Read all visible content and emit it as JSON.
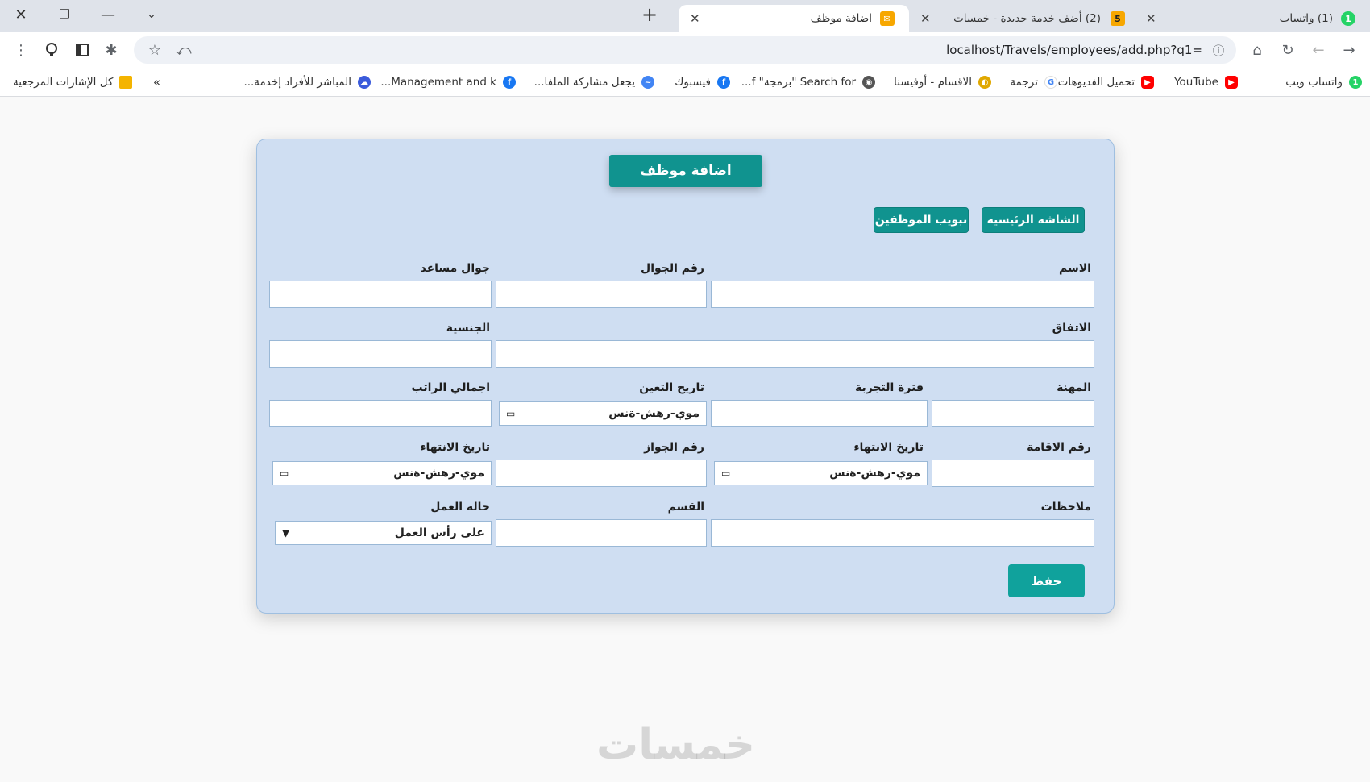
{
  "browser": {
    "tabs": [
      {
        "title": "(1) واتساب",
        "favicon": "whatsapp-icon"
      },
      {
        "title": "(2) أضف خدمة جديدة - خمسات",
        "favicon_text": "5"
      },
      {
        "title": "اضافة موظف",
        "favicon": "page-icon"
      }
    ],
    "url": "localhost/Travels/employees/add.php?q1=",
    "bookmarks": [
      {
        "label": "واتساب ويب",
        "icon": "whatsapp-icon",
        "color": "#25d366"
      },
      {
        "label": "YouTube",
        "icon": "youtube-icon",
        "color": "#ff0000"
      },
      {
        "label": "تحميل الفديوهات",
        "icon": "youtube-icon",
        "color": "#ff0000"
      },
      {
        "label": "ترجمة",
        "icon": "google-icon",
        "color": "#4285f4"
      },
      {
        "label": "الاقسام - أوفيسنا",
        "icon": "officena-icon",
        "color": "#e0a800"
      },
      {
        "label": "Search for \"برمجة\" f...",
        "icon": "globe-icon",
        "color": "#555555"
      },
      {
        "label": "فيسبوك",
        "icon": "facebook-icon",
        "color": "#1877f2"
      },
      {
        "label": "يجعل مشاركة الملفا...",
        "icon": "wetransfer-icon",
        "color": "#4285f4"
      },
      {
        "label": "Management and k...",
        "icon": "facebook-icon",
        "color": "#1877f2"
      },
      {
        "label": "المباشر للأفراد إخدمة...",
        "icon": "cloud-icon",
        "color": "#3b5bdb"
      },
      {
        "label": "»"
      },
      {
        "label": "كل الإشارات المرجعية",
        "icon": "folder-icon",
        "color": "#f4b400"
      }
    ]
  },
  "form": {
    "title": "اضافة موظف",
    "nav": {
      "home": "الشاشة الرئيسية",
      "employees_tab": "تبويب الموظفين"
    },
    "labels": {
      "name": "الاسم",
      "mobile": "رقم الجوال",
      "alt_mobile": "جوال مساعد",
      "agreement": "الاتفاق",
      "nationality": "الجنسية",
      "profession": "المهنة",
      "trial_period": "فترة التجربة",
      "hire_date": "تاريخ التعين",
      "total_salary": "اجمالي الراتب",
      "residence_no": "رقم الاقامة",
      "residence_expiry": "تاريخ الانتهاء",
      "passport_no": "رقم الجواز",
      "passport_expiry": "تاريخ الانتهاء",
      "notes": "ملاحظات",
      "department": "القسم",
      "work_status": "حالة العمل"
    },
    "date_placeholder": "موي-رهش-ةنس",
    "work_status_value": "على رأس العمل",
    "save": "حفظ"
  },
  "watermark": "خمسات"
}
